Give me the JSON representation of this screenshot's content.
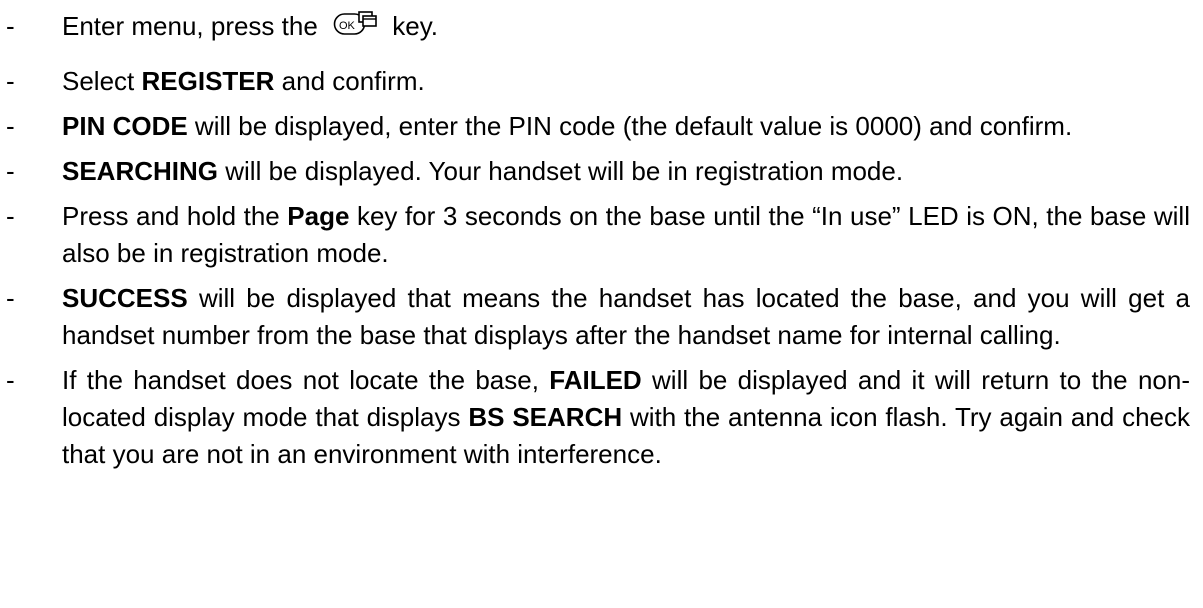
{
  "instructions": {
    "bullet": "-",
    "item1": {
      "t1": "Enter menu, press the ",
      "icon": "ok-menu-key-icon",
      "icon_text": "OK",
      "t2": " key."
    },
    "item2": {
      "t1": "Select ",
      "b1": "REGISTER",
      "t2": " and confirm."
    },
    "item3": {
      "b1": "PIN CODE",
      "t1": " will be displayed, enter the PIN code (the default value is 0000) and confirm."
    },
    "item4": {
      "b1": "SEARCHING",
      "t1": " will be displayed. Your handset will be in registration mode."
    },
    "item5": {
      "t1": "Press and hold the ",
      "b1": "Page",
      "t2": " key for 3 seconds on the base until the “In use” LED is ON, the base will also be in registration mode."
    },
    "item6": {
      "b1": "SUCCESS",
      "t1": " will be displayed that means the handset has located the base, and you will get a handset number from the base that displays after the handset name for internal calling."
    },
    "item7": {
      "t1": "If the handset does not locate the base, ",
      "b1": "FAILED",
      "t2": " will be displayed and it will return to the non-located display mode that displays ",
      "b2": "BS SEARCH",
      "t3": " with the antenna icon flash. Try again and check that you are not in an environment with interference."
    }
  }
}
